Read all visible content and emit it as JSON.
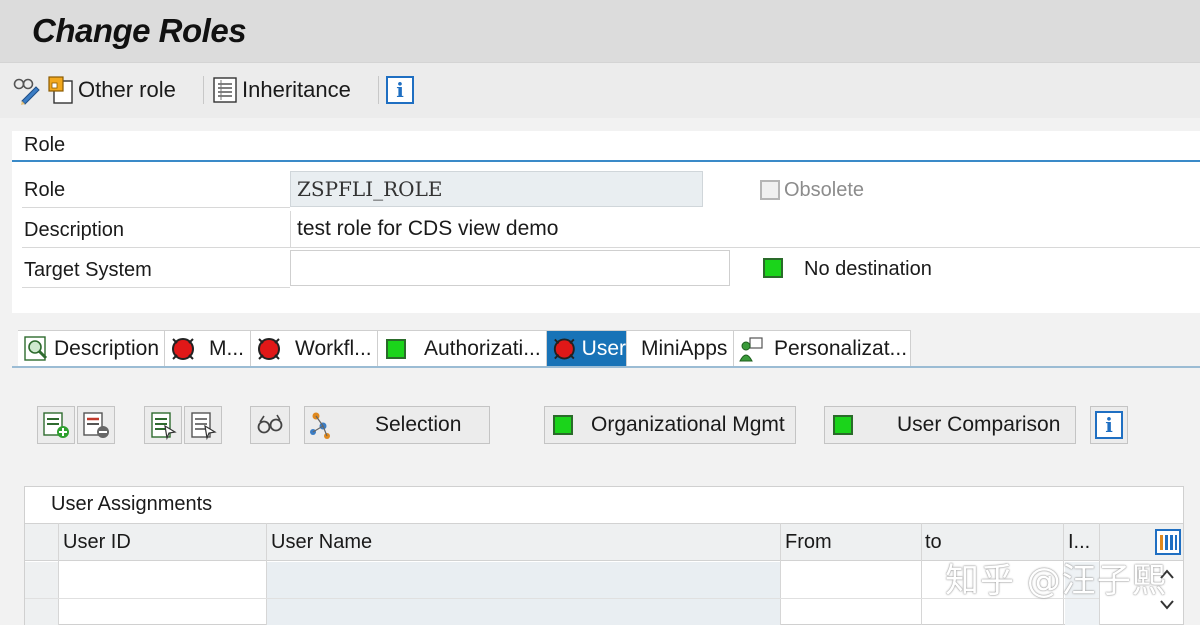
{
  "window": {
    "title": "Change Roles"
  },
  "toolbar": {
    "other_role_label": "Other role",
    "inheritance_label": "Inheritance",
    "info_glyph": "i"
  },
  "role_section": {
    "header": "Role",
    "role_label": "Role",
    "role_value": "ZSPFLI_ROLE",
    "obsolete_label": "Obsolete",
    "obsolete_checked": false,
    "description_label": "Description",
    "description_value": "test role for CDS view demo",
    "target_system_label": "Target System",
    "target_system_value": "",
    "destination_status": "No destination",
    "destination_status_color": "#1bd41b"
  },
  "tabs": [
    {
      "label": "Description",
      "icon": "document-magnifier-icon",
      "active": false
    },
    {
      "label": "M...",
      "icon": "red-status-icon",
      "active": false
    },
    {
      "label": "Workfl...",
      "icon": "red-status-icon",
      "active": false
    },
    {
      "label": "Authorizati...",
      "icon": "green-status-icon",
      "active": false
    },
    {
      "label": "User",
      "icon": "red-status-icon",
      "active": true
    },
    {
      "label": "MiniApps",
      "icon": "",
      "active": false
    },
    {
      "label": "Personalizat...",
      "icon": "person-icon",
      "active": false
    }
  ],
  "user_tab": {
    "selection_label": "Selection",
    "org_mgmt_label": "Organizational Mgmt",
    "user_comparison_label": "User Comparison",
    "info_glyph": "i"
  },
  "user_assignments": {
    "title": "User Assignments",
    "columns": [
      "User ID",
      "User Name",
      "From",
      "to",
      "I..."
    ],
    "rows": [
      {
        "user_id": "",
        "user_name": "",
        "from": "",
        "to": "",
        "i": ""
      },
      {
        "user_id": "",
        "user_name": "",
        "from": "",
        "to": "",
        "i": ""
      }
    ]
  },
  "watermark": "知乎 @汪子熙",
  "colors": {
    "accent_blue": "#1873b7",
    "status_green": "#1bd41b",
    "status_red": "#e01818"
  }
}
